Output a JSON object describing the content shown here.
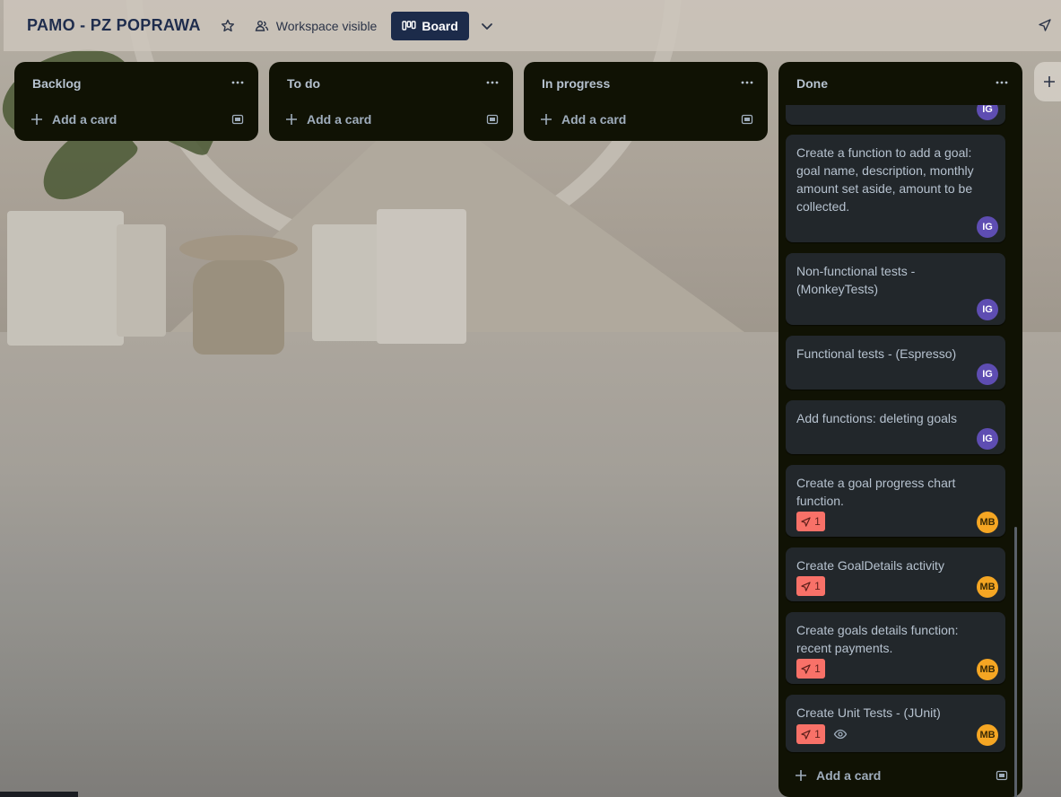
{
  "header": {
    "board_title": "PAMO - PZ POPRAWA",
    "visibility_label": "Workspace visible",
    "view_label": "Board",
    "icons": [
      "star-icon",
      "workspace-visible-icon",
      "board-icon",
      "chevron-down-icon",
      "pin-icon"
    ]
  },
  "lists": [
    {
      "title": "Backlog",
      "add_card_label": "Add a card"
    },
    {
      "title": "To do",
      "add_card_label": "Add a card"
    },
    {
      "title": "In progress",
      "add_card_label": "Add a card"
    }
  ],
  "done": {
    "title": "Done",
    "add_card_label": "Add a card",
    "cards": [
      {
        "text": "",
        "avatar": "IG"
      },
      {
        "text": "Create a function to add a goal: goal name, description, monthly amount set aside, amount to be collected.",
        "avatar": "IG"
      },
      {
        "text": "Non-functional tests - (MonkeyTests)",
        "avatar": "IG"
      },
      {
        "text": "Functional tests - (Espresso)",
        "avatar": "IG"
      },
      {
        "text": "Add functions: deleting goals",
        "avatar": "IG"
      },
      {
        "text": "Create a goal progress chart function.",
        "avatar": "MB",
        "badge": "1"
      },
      {
        "text": "Create GoalDetails activity",
        "avatar": "MB",
        "badge": "1"
      },
      {
        "text": "Create goals details function: recent payments.",
        "avatar": "MB",
        "badge": "1"
      },
      {
        "text": "Create Unit Tests - (JUnit)",
        "avatar": "MB",
        "badge": "1",
        "watching": true
      }
    ]
  },
  "colors": {
    "list_bg": "#101204",
    "card_bg": "#22272b",
    "text": "#b6c2cf",
    "header_title": "#1f2d4d",
    "board_button": "#1c2b4a",
    "avatar_ig": "#5e4db2",
    "avatar_mb": "#f5a623",
    "badge_red": "#f87168"
  }
}
